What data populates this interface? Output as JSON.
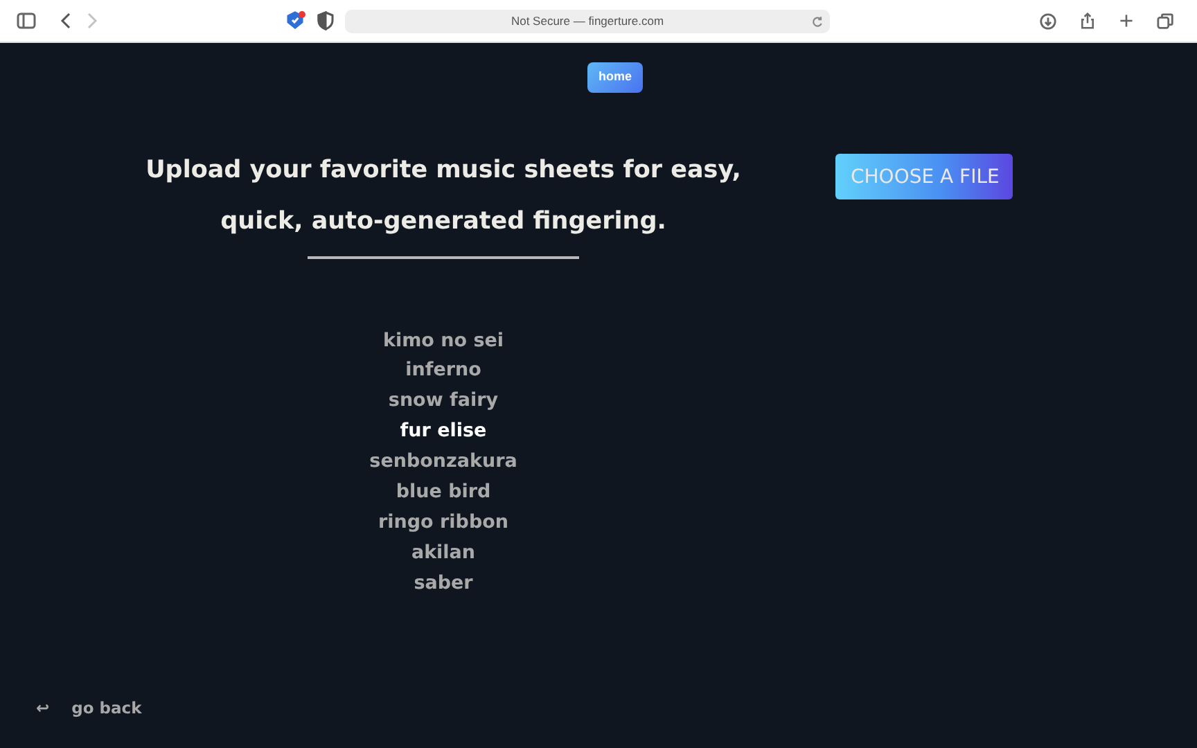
{
  "browser": {
    "address": "Not Secure — fingerture.com",
    "back_disabled": false,
    "forward_disabled": true
  },
  "nav": {
    "home": "home"
  },
  "heading": {
    "line_1": "Upload your favorite music sheets for easy,",
    "line_2": "quick, auto-generated fingering."
  },
  "upload_button": "CHOOSE A FILE",
  "songs": [
    {
      "title": "kimo no sei",
      "selected": false
    },
    {
      "title": "inferno",
      "selected": false
    },
    {
      "title": "snow fairy",
      "selected": false
    },
    {
      "title": "fur elise",
      "selected": true
    },
    {
      "title": "senbonzakura",
      "selected": false
    },
    {
      "title": "blue bird",
      "selected": false
    },
    {
      "title": "ringo ribbon",
      "selected": false
    },
    {
      "title": "akilan",
      "selected": false
    },
    {
      "title": "saber",
      "selected": false
    }
  ],
  "go_back": {
    "icon": "↩",
    "label": "go back"
  }
}
